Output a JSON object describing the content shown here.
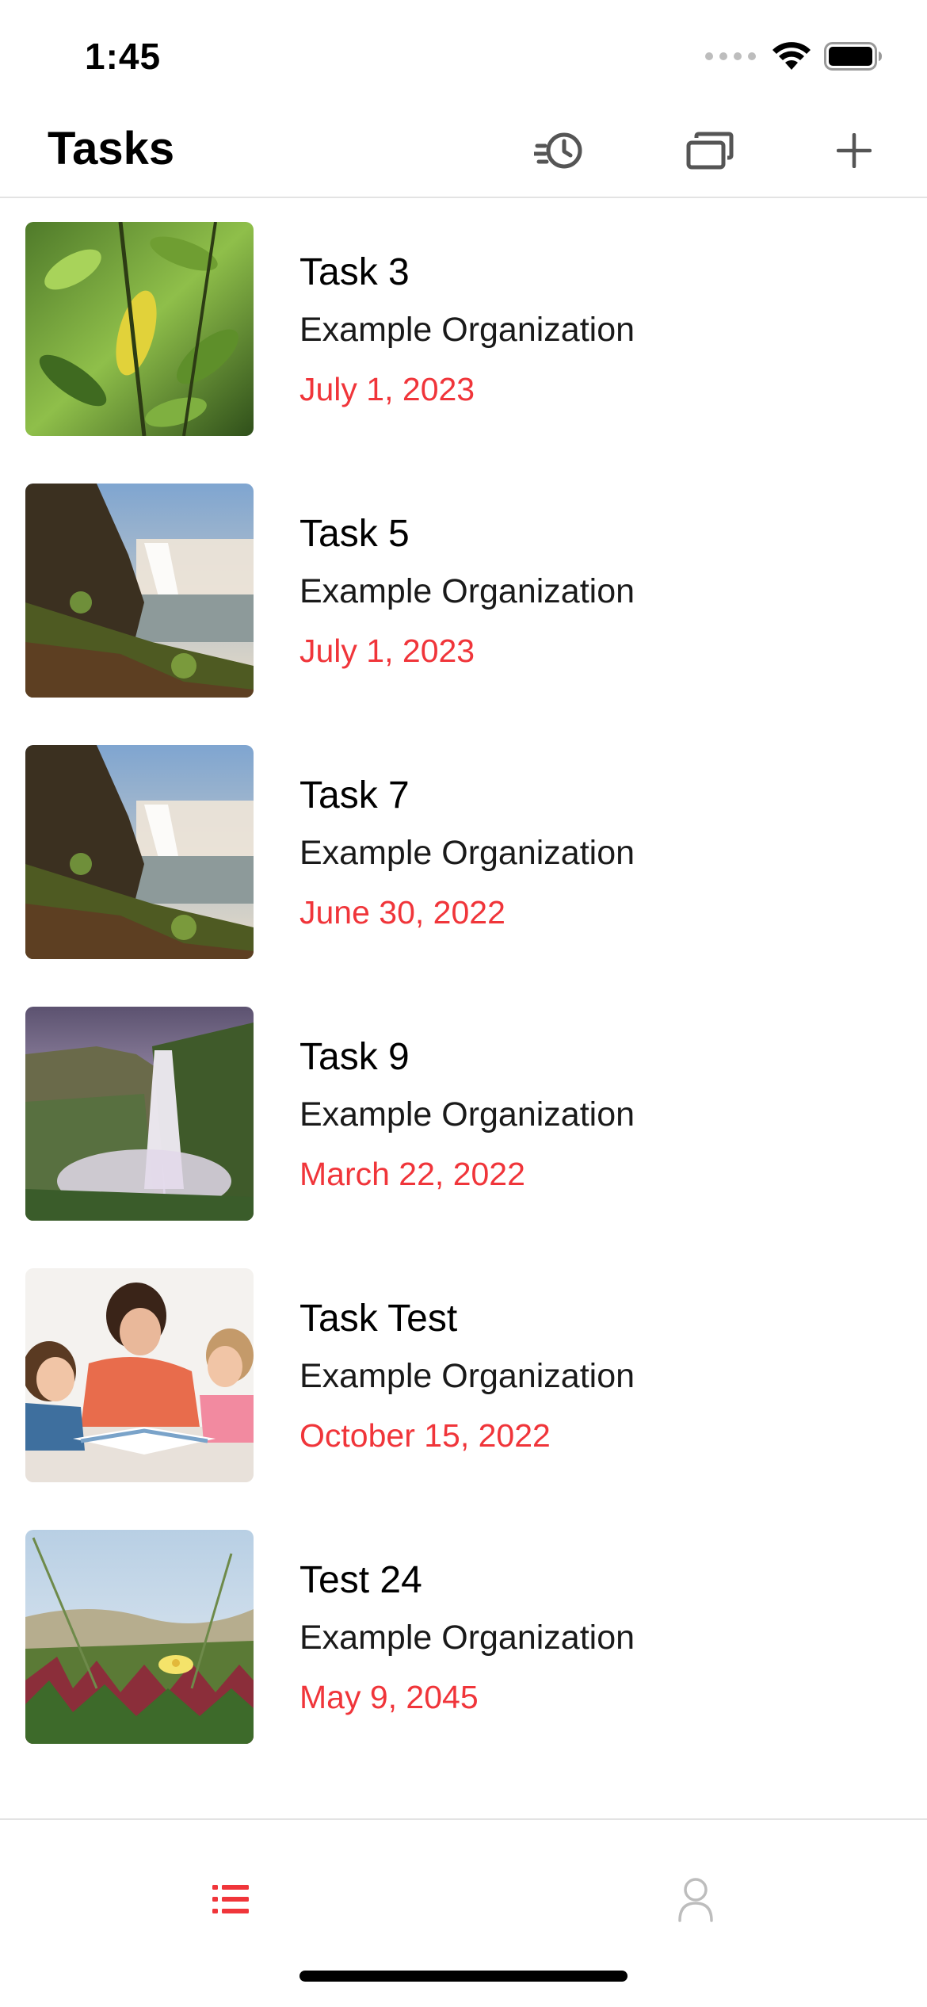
{
  "status_bar": {
    "time": "1:45",
    "icons": [
      "cellular-signal-icon",
      "wifi-icon",
      "battery-icon"
    ]
  },
  "nav": {
    "title": "Tasks",
    "buttons": [
      "history-clock-icon",
      "gallery-stack-icon",
      "plus-icon"
    ]
  },
  "colors": {
    "accent": "#f0353a",
    "text": "#000000",
    "divider": "#e3e3e3",
    "inactive_tab": "#bdbdbd"
  },
  "tasks": [
    {
      "title": "Task 3",
      "organization": "Example Organization",
      "date": "July 1, 2023",
      "image": "leaves-photo"
    },
    {
      "title": "Task 5",
      "organization": "Example Organization",
      "date": "July 1, 2023",
      "image": "waterfall-cliff-photo"
    },
    {
      "title": "Task 7",
      "organization": "Example Organization",
      "date": "June 30, 2022",
      "image": "waterfall-cliff-photo"
    },
    {
      "title": "Task 9",
      "organization": "Example Organization",
      "date": "March 22, 2022",
      "image": "misty-waterfall-photo"
    },
    {
      "title": "Task Test",
      "organization": "Example Organization",
      "date": "October 15, 2022",
      "image": "family-reading-photo"
    },
    {
      "title": "Test 24",
      "organization": "Example Organization",
      "date": "May 9, 2045",
      "image": "dune-flowers-photo"
    }
  ],
  "tab_bar": {
    "tabs": [
      {
        "icon": "list-icon",
        "selected": true
      },
      {
        "icon": "person-icon",
        "selected": false
      }
    ]
  }
}
